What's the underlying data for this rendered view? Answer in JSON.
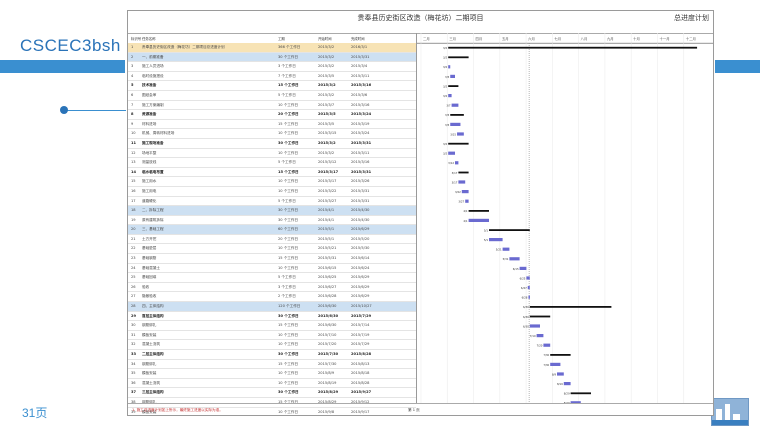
{
  "slide": {
    "brand": "CSCEC3bsh",
    "page_number": "31页"
  },
  "sheet": {
    "title": "贵奉县历史街区改造（梅花坊）二期项目",
    "right_title": "总进度计划",
    "columns": [
      "标识号",
      "任务名称",
      "工期",
      "开始时间",
      "完成时间"
    ],
    "footer_page": "第 1 页",
    "footer_note": "1. 施工总进度计划如上所示，最终施工进度以实际为准。"
  },
  "rows": [
    {
      "no": "1",
      "name": "贵奉县历史街区改造（梅花坊）二期项目总进度计划",
      "dur": "366 个工作日",
      "start": "2015/3/2",
      "end": "2016/3/1",
      "style": "hl"
    },
    {
      "no": "2",
      "name": "一、前期准备",
      "dur": "30 个工作日",
      "start": "2015/3/2",
      "end": "2015/3/31",
      "style": "hl2"
    },
    {
      "no": "3",
      "name": "施工人员进场",
      "dur": "3 个工作日",
      "start": "2015/3/2",
      "end": "2015/3/4",
      "style": ""
    },
    {
      "no": "4",
      "name": "临时设施搭设",
      "dur": "7 个工作日",
      "start": "2015/3/5",
      "end": "2015/3/11",
      "style": ""
    },
    {
      "no": "5",
      "name": "技术准备",
      "dur": "15 个工作日",
      "start": "2015/3/2",
      "end": "2015/3/16",
      "style": "bold"
    },
    {
      "no": "6",
      "name": "图纸会审",
      "dur": "5 个工作日",
      "start": "2015/3/2",
      "end": "2015/3/6",
      "style": ""
    },
    {
      "no": "7",
      "name": "施工方案编制",
      "dur": "10 个工作日",
      "start": "2015/3/7",
      "end": "2015/3/16",
      "style": ""
    },
    {
      "no": "8",
      "name": "资源准备",
      "dur": "20 个工作日",
      "start": "2015/3/5",
      "end": "2015/3/24",
      "style": "bold"
    },
    {
      "no": "9",
      "name": "材料进场",
      "dur": "15 个工作日",
      "start": "2015/3/5",
      "end": "2015/3/19",
      "style": ""
    },
    {
      "no": "10",
      "name": "机械、周转材料进场",
      "dur": "10 个工作日",
      "start": "2015/3/15",
      "end": "2015/3/24",
      "style": ""
    },
    {
      "no": "11",
      "name": "施工现场准备",
      "dur": "30 个工作日",
      "start": "2015/3/2",
      "end": "2015/3/31",
      "style": "bold"
    },
    {
      "no": "12",
      "name": "场地平整",
      "dur": "10 个工作日",
      "start": "2015/3/2",
      "end": "2015/3/11",
      "style": ""
    },
    {
      "no": "13",
      "name": "测量放线",
      "dur": "5 个工作日",
      "start": "2015/3/12",
      "end": "2015/3/16",
      "style": ""
    },
    {
      "no": "14",
      "name": "临水临电布置",
      "dur": "15 个工作日",
      "start": "2015/3/17",
      "end": "2015/3/31",
      "style": "bold"
    },
    {
      "no": "15",
      "name": "施工用水",
      "dur": "10 个工作日",
      "start": "2015/3/17",
      "end": "2015/3/26",
      "style": ""
    },
    {
      "no": "16",
      "name": "施工用电",
      "dur": "10 个工作日",
      "start": "2015/3/22",
      "end": "2015/3/31",
      "style": ""
    },
    {
      "no": "17",
      "name": "道路硬化",
      "dur": "5 个工作日",
      "start": "2015/3/27",
      "end": "2015/3/31",
      "style": ""
    },
    {
      "no": "18",
      "name": "二、拆除工程",
      "dur": "30 个工作日",
      "start": "2015/4/1",
      "end": "2015/4/30",
      "style": "hl2"
    },
    {
      "no": "19",
      "name": "原有建筑拆除",
      "dur": "30 个工作日",
      "start": "2015/4/1",
      "end": "2015/4/30",
      "style": ""
    },
    {
      "no": "20",
      "name": "三、基础工程",
      "dur": "60 个工作日",
      "start": "2015/5/1",
      "end": "2015/6/29",
      "style": "hl2"
    },
    {
      "no": "21",
      "name": "土方开挖",
      "dur": "20 个工作日",
      "start": "2015/5/1",
      "end": "2015/5/20",
      "style": ""
    },
    {
      "no": "22",
      "name": "基础垫层",
      "dur": "10 个工作日",
      "start": "2015/5/21",
      "end": "2015/5/30",
      "style": ""
    },
    {
      "no": "23",
      "name": "基础钢筋",
      "dur": "15 个工作日",
      "start": "2015/5/31",
      "end": "2015/6/14",
      "style": ""
    },
    {
      "no": "24",
      "name": "基础混凝土",
      "dur": "10 个工作日",
      "start": "2015/6/15",
      "end": "2015/6/24",
      "style": ""
    },
    {
      "no": "25",
      "name": "基础回填",
      "dur": "5 个工作日",
      "start": "2015/6/25",
      "end": "2015/6/29",
      "style": ""
    },
    {
      "no": "26",
      "name": "验收",
      "dur": "3 个工作日",
      "start": "2015/6/27",
      "end": "2015/6/29",
      "style": ""
    },
    {
      "no": "27",
      "name": "隐蔽验收",
      "dur": "2 个工作日",
      "start": "2015/6/28",
      "end": "2015/6/29",
      "style": ""
    },
    {
      "no": "28",
      "name": "四、主体结构",
      "dur": "120 个工作日",
      "start": "2015/6/30",
      "end": "2015/10/27",
      "style": "hl2"
    },
    {
      "no": "29",
      "name": "首层主体结构",
      "dur": "30 个工作日",
      "start": "2015/6/30",
      "end": "2015/7/29",
      "style": "bold"
    },
    {
      "no": "30",
      "name": "钢筋绑扎",
      "dur": "15 个工作日",
      "start": "2015/6/30",
      "end": "2015/7/14",
      "style": ""
    },
    {
      "no": "31",
      "name": "模板安装",
      "dur": "10 个工作日",
      "start": "2015/7/10",
      "end": "2015/7/19",
      "style": ""
    },
    {
      "no": "32",
      "name": "混凝土浇筑",
      "dur": "10 个工作日",
      "start": "2015/7/20",
      "end": "2015/7/29",
      "style": ""
    },
    {
      "no": "33",
      "name": "二层主体结构",
      "dur": "30 个工作日",
      "start": "2015/7/30",
      "end": "2015/8/28",
      "style": "bold"
    },
    {
      "no": "34",
      "name": "钢筋绑扎",
      "dur": "15 个工作日",
      "start": "2015/7/30",
      "end": "2015/8/13",
      "style": ""
    },
    {
      "no": "35",
      "name": "模板安装",
      "dur": "10 个工作日",
      "start": "2015/8/9",
      "end": "2015/8/18",
      "style": ""
    },
    {
      "no": "36",
      "name": "混凝土浇筑",
      "dur": "10 个工作日",
      "start": "2015/8/19",
      "end": "2015/8/28",
      "style": ""
    },
    {
      "no": "37",
      "name": "三层主体结构",
      "dur": "30 个工作日",
      "start": "2015/8/29",
      "end": "2015/9/27",
      "style": "bold"
    },
    {
      "no": "38",
      "name": "钢筋绑扎",
      "dur": "15 个工作日",
      "start": "2015/8/29",
      "end": "2015/9/12",
      "style": ""
    },
    {
      "no": "39",
      "name": "模板安装",
      "dur": "10 个工作日",
      "start": "2015/9/8",
      "end": "2015/9/17",
      "style": ""
    },
    {
      "no": "40",
      "name": "混凝土浇筑",
      "dur": "10 个工作日",
      "start": "2015/9/18",
      "end": "2015/9/27",
      "style": ""
    },
    {
      "no": "41",
      "name": "屋面结构",
      "dur": "30 个工作日",
      "start": "2015/9/28",
      "end": "2015/10/27",
      "style": "bold"
    },
    {
      "no": "42",
      "name": "结构验收",
      "dur": "5 个工作日",
      "start": "2015/10/23",
      "end": "2015/10/27",
      "style": ""
    }
  ],
  "gantt": {
    "start_date": "2015/3/2",
    "end_date": "2016/3/1",
    "months": [
      "二月",
      "三月",
      "四月",
      "五月",
      "六月",
      "七月",
      "八月",
      "九月",
      "十月",
      "十一月",
      "十二月"
    ],
    "bar_color": "#6a6ad0",
    "summary_color": "#111111",
    "today_line": "2015/6/29"
  }
}
